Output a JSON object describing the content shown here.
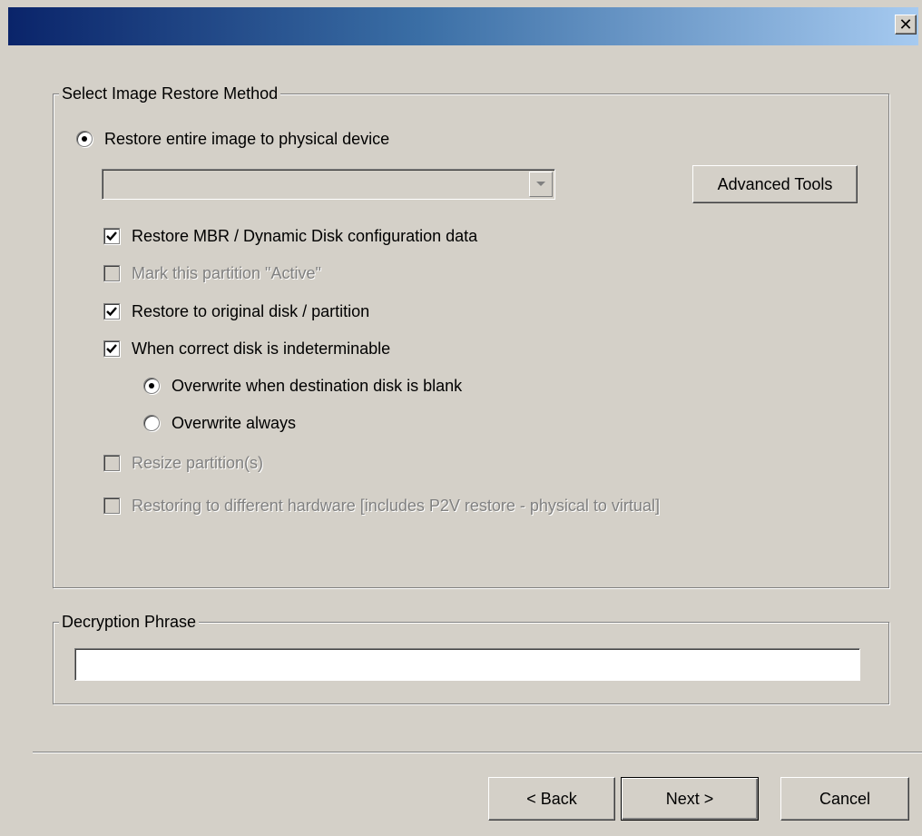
{
  "window": {
    "title": "",
    "close_glyph": "✕"
  },
  "restore_method": {
    "legend": "Select Image Restore Method",
    "radio_restore_entire": {
      "label": "Restore entire image to physical device",
      "selected": true
    },
    "device_dropdown": {
      "value": ""
    },
    "advanced_tools_label": "Advanced Tools",
    "options": [
      {
        "label": "Restore MBR / Dynamic Disk configuration data",
        "checked": true,
        "enabled": true
      },
      {
        "label": "Mark this partition \"Active\"",
        "checked": false,
        "enabled": false
      },
      {
        "label": "Restore to original disk / partition",
        "checked": true,
        "enabled": true
      },
      {
        "label": "When correct disk is indeterminable",
        "checked": true,
        "enabled": true
      }
    ],
    "sub_options": [
      {
        "label": "Overwrite when destination disk is blank",
        "selected": true
      },
      {
        "label": "Overwrite always",
        "selected": false
      }
    ],
    "more_options": [
      {
        "label": "Resize partition(s)",
        "checked": false,
        "enabled": false
      },
      {
        "label": "Restoring to different hardware [includes P2V restore - physical to virtual]",
        "checked": false,
        "enabled": false
      }
    ]
  },
  "decryption": {
    "legend": "Decryption Phrase",
    "value": ""
  },
  "footer": {
    "back_label": "< Back",
    "next_label": "Next >",
    "cancel_label": "Cancel"
  }
}
